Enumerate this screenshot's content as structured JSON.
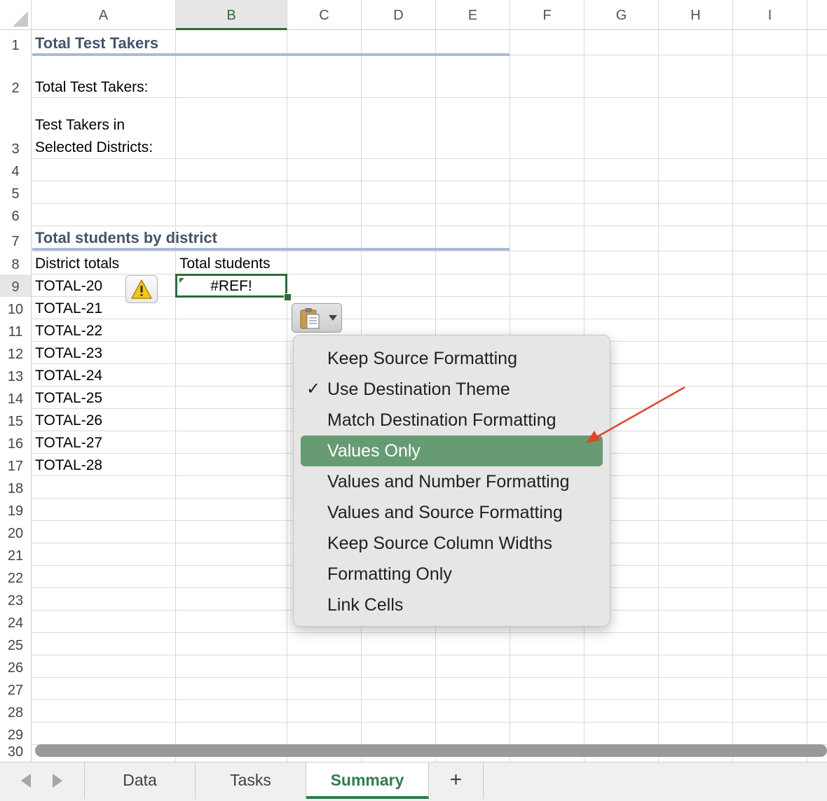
{
  "columns": [
    "A",
    "B",
    "C",
    "D",
    "E",
    "F",
    "G",
    "H",
    "I"
  ],
  "selected_column": "B",
  "rows": [
    "1",
    "2",
    "3",
    "4",
    "5",
    "6",
    "7",
    "8",
    "9",
    "10",
    "11",
    "12",
    "13",
    "14",
    "15",
    "16",
    "17",
    "18",
    "19",
    "20",
    "21",
    "22",
    "23",
    "24",
    "25",
    "26",
    "27",
    "28",
    "29",
    "30"
  ],
  "selected_row": "9",
  "cells": {
    "a1": "Total Test Takers",
    "a2": "Total Test Takers:",
    "a3_line1": "Test Takers in",
    "a3_line2": "Selected Districts:",
    "a7": "Total students by district",
    "a8": "District totals",
    "b8": "Total students",
    "b9": "#REF!",
    "district_totals": [
      "TOTAL-20",
      "TOTAL-21",
      "TOTAL-22",
      "TOTAL-23",
      "TOTAL-24",
      "TOTAL-25",
      "TOTAL-26",
      "TOTAL-27",
      "TOTAL-28"
    ]
  },
  "paste_menu": {
    "items": [
      {
        "label": "Keep Source Formatting",
        "checked": false,
        "highlighted": false
      },
      {
        "label": "Use Destination Theme",
        "checked": true,
        "highlighted": false
      },
      {
        "label": "Match Destination Formatting",
        "checked": false,
        "highlighted": false
      },
      {
        "label": "Values Only",
        "checked": false,
        "highlighted": true
      },
      {
        "label": "Values and Number Formatting",
        "checked": false,
        "highlighted": false
      },
      {
        "label": "Values and Source Formatting",
        "checked": false,
        "highlighted": false
      },
      {
        "label": "Keep Source Column Widths",
        "checked": false,
        "highlighted": false
      },
      {
        "label": "Formatting Only",
        "checked": false,
        "highlighted": false
      },
      {
        "label": "Link Cells",
        "checked": false,
        "highlighted": false
      }
    ],
    "check_glyph": "✓"
  },
  "icons": {
    "warning": "warning-icon",
    "paste": "clipboard-icon",
    "annotation_arrow": "red-arrow"
  },
  "colors": {
    "accent_green": "#2e6b3a",
    "menu_highlight": "#679b74",
    "title_text": "#44546a",
    "arrow_red": "#e0442c"
  },
  "sheet_tabs": {
    "tabs": [
      "Data",
      "Tasks",
      "Summary"
    ],
    "active": "Summary",
    "add_label": "+"
  }
}
